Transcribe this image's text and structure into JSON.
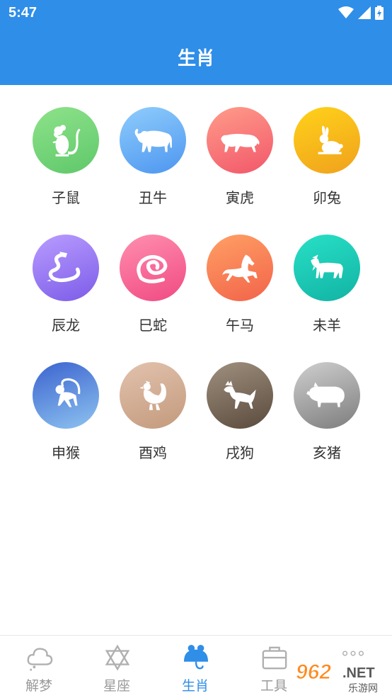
{
  "status": {
    "time": "5:47"
  },
  "header": {
    "title": "生肖"
  },
  "zodiac": [
    {
      "label": "子鼠",
      "icon": "rat-icon",
      "gradient": [
        "#8ee28a",
        "#5fc86a"
      ]
    },
    {
      "label": "丑牛",
      "icon": "ox-icon",
      "gradient": [
        "#8fcdfc",
        "#4d96f0"
      ]
    },
    {
      "label": "寅虎",
      "icon": "tiger-icon",
      "gradient": [
        "#ff9c8a",
        "#f2576a"
      ]
    },
    {
      "label": "卯兔",
      "icon": "rabbit-icon",
      "gradient": [
        "#ffd21a",
        "#f0a11c"
      ]
    },
    {
      "label": "辰龙",
      "icon": "dragon-icon",
      "gradient": [
        "#b99cff",
        "#7c5ce8"
      ]
    },
    {
      "label": "巳蛇",
      "icon": "snake-icon",
      "gradient": [
        "#ff8fb0",
        "#f04a82"
      ]
    },
    {
      "label": "午马",
      "icon": "horse-icon",
      "gradient": [
        "#ffa064",
        "#f2634a"
      ]
    },
    {
      "label": "未羊",
      "icon": "goat-icon",
      "gradient": [
        "#28e0c6",
        "#12b3a4"
      ]
    },
    {
      "label": "申猴",
      "icon": "monkey-icon",
      "gradient": [
        "#3b63cf",
        "#8ec3f0"
      ]
    },
    {
      "label": "酉鸡",
      "icon": "rooster-icon",
      "gradient": [
        "#e2c2ae",
        "#c39a7c"
      ]
    },
    {
      "label": "戌狗",
      "icon": "dog-icon",
      "gradient": [
        "#9f907f",
        "#5a4a3c"
      ]
    },
    {
      "label": "亥猪",
      "icon": "pig-icon",
      "gradient": [
        "#cfcfcf",
        "#7d7d7d"
      ]
    }
  ],
  "tabs": [
    {
      "label": "解梦",
      "icon": "cloud-icon"
    },
    {
      "label": "星座",
      "icon": "star-of-david-icon"
    },
    {
      "label": "生肖",
      "icon": "mouse-icon",
      "active": true
    },
    {
      "label": "工具",
      "icon": "toolbox-icon"
    }
  ],
  "colors": {
    "accent": "#2f8ee8",
    "inactive": "#9a9a9a"
  },
  "watermark": {
    "main": "962",
    "suffix": ".NET",
    "sub": "乐游网"
  }
}
